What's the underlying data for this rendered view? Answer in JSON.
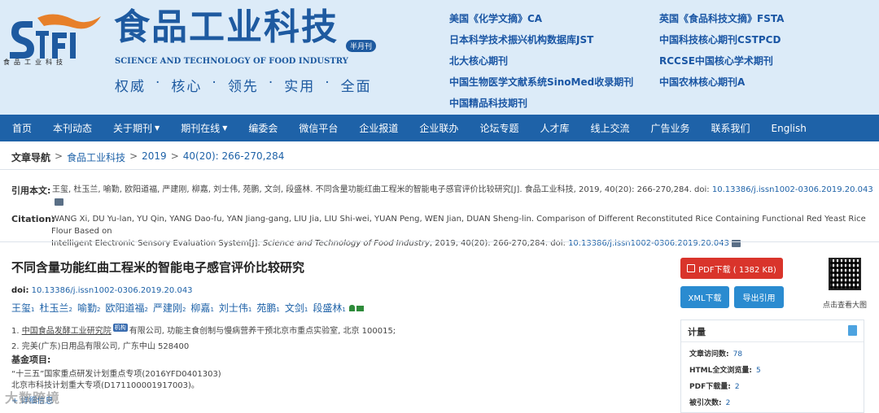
{
  "brand": {
    "logo_sub": "食品工业科技",
    "journal_cn": "食品工业科技",
    "semi_monthly": "半月刊",
    "journal_en": "SCIENCE AND TECHNOLOGY OF FOOD INDUSTRY",
    "slogan": [
      "权威",
      "核心",
      "领先",
      "实用",
      "全面"
    ],
    "primary_color": "#1e62a8",
    "header_bg": "#dcebf8"
  },
  "indexes": {
    "left": [
      "美国《化学文摘》CA",
      "日本科学技术振兴机构数据库JST",
      "北大核心期刊",
      "中国生物医学文献系统SinoMed收录期刊",
      "中国精品科技期刊"
    ],
    "right": [
      "英国《食品科技文摘》FSTA",
      "中国科技核心期刊CSTPCD",
      "RCCSE中国核心学术期刊",
      "中国农林核心期刊A"
    ]
  },
  "nav": [
    {
      "label": "首页",
      "dropdown": false
    },
    {
      "label": "本刊动态",
      "dropdown": false
    },
    {
      "label": "关于期刊",
      "dropdown": true
    },
    {
      "label": "期刊在线",
      "dropdown": true
    },
    {
      "label": "编委会",
      "dropdown": false
    },
    {
      "label": "微信平台",
      "dropdown": false
    },
    {
      "label": "企业报道",
      "dropdown": false
    },
    {
      "label": "企业联办",
      "dropdown": false
    },
    {
      "label": "论坛专题",
      "dropdown": false
    },
    {
      "label": "人才库",
      "dropdown": false
    },
    {
      "label": "线上交流",
      "dropdown": false
    },
    {
      "label": "广告业务",
      "dropdown": false
    },
    {
      "label": "联系我们",
      "dropdown": false
    },
    {
      "label": "English",
      "dropdown": false
    }
  ],
  "breadcrumb": {
    "label": "文章导航",
    "items": [
      "食品工业科技",
      "2019",
      "40(20): 266-270,284"
    ],
    "sep": ">"
  },
  "cite_cn": {
    "label": "引用本文:",
    "text": "王玺, 杜玉兰, 喻勤, 欧阳道福, 严建刚, 柳嘉, 刘士伟, 苑鹏, 文剑, 段盛林. 不同含量功能红曲工程米的智能电子感官评价比较研究[J]. 食品工业科技, 2019, 40(20): 266-270,284. doi:",
    "doi": "10.13386/j.issn1002-0306.2019.20.043"
  },
  "cite_en": {
    "label": "Citation:",
    "line1": "WANG Xi, DU Yu-lan, YU Qin, YANG Dao-fu, YAN Jiang-gang, LIU Jia, LIU Shi-wei, YUAN Peng, WEN Jian, DUAN Sheng-lin. Comparison of Different Reconstituted Rice Containing Functional Red Yeast Rice Flour Based on",
    "line2a": "Intelligent Electronic Sensory Evaluation System[J].",
    "line2_journal": "Science and Technology of Food Industry",
    "line2b": ", 2019, 40(20): 266-270,284. doi:",
    "doi": "10.13386/j.issn1002-0306.2019.20.043"
  },
  "article": {
    "title": "不同含量功能红曲工程米的智能电子感官评价比较研究",
    "doi_label": "doi:",
    "doi": "10.13386/j.issn1002-0306.2019.20.043",
    "authors": [
      {
        "name": "王玺",
        "sup": "1"
      },
      {
        "name": "杜玉兰",
        "sup": "2"
      },
      {
        "name": "喻勤",
        "sup": "2"
      },
      {
        "name": "欧阳道福",
        "sup": "2"
      },
      {
        "name": "严建刚",
        "sup": "2"
      },
      {
        "name": "柳嘉",
        "sup": "1"
      },
      {
        "name": "刘士伟",
        "sup": "1"
      },
      {
        "name": "苑鹏",
        "sup": "1"
      },
      {
        "name": "文剑",
        "sup": "1"
      },
      {
        "name": "段盛林",
        "sup": "1"
      }
    ],
    "aff1_num": "1.",
    "aff1_inst": "中国食品发酵工业研究院",
    "aff1_tag": "机构",
    "aff1_rest": "有限公司, 功能主食创制与慢病营养干预北京市重点实验室, 北京 100015;",
    "aff2": "2. 完美(广东)日用品有限公司, 广东中山 528400",
    "fund_label": "基金项目:",
    "fund1": "“十三五”国家重点研发计划重点专项(2016YFD0401303)",
    "fund2": "北京市科技计划重大专项(D171100001917003)。",
    "more": "+ 详细信息"
  },
  "watermark": "大数跨境",
  "buttons": {
    "pdf": "PDF下载 ( 1382 KB)",
    "xml": "XML下载",
    "export": "导出引用",
    "qr_caption": "点击查看大图"
  },
  "stats": {
    "title": "计量",
    "rows": [
      {
        "label": "文章访问数:",
        "value": "78"
      },
      {
        "label": "HTML全文浏览量:",
        "value": "5"
      },
      {
        "label": "PDF下载量:",
        "value": "2"
      },
      {
        "label": "被引次数:",
        "value": "2"
      }
    ]
  }
}
